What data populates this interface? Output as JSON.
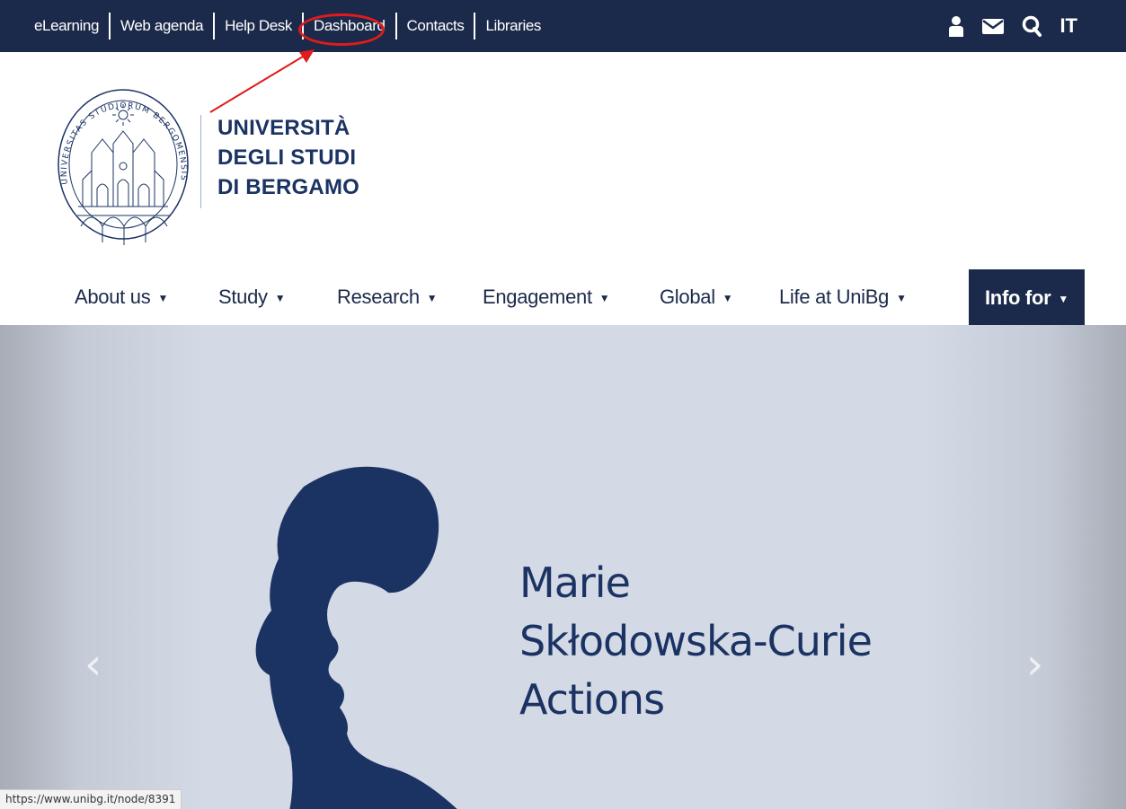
{
  "topbar": {
    "links": [
      {
        "label": "eLearning"
      },
      {
        "label": "Web agenda"
      },
      {
        "label": "Help Desk"
      },
      {
        "label": "Dashboard"
      },
      {
        "label": "Contacts"
      },
      {
        "label": "Libraries"
      }
    ],
    "icons": [
      "user-icon",
      "mail-icon",
      "search-icon"
    ],
    "language": "IT"
  },
  "logo": {
    "seal_text": "UNIVERSITAS STUDIORUM BERGOMENSIS",
    "line1": "UNIVERSITÀ",
    "line2": "DEGLI STUDI",
    "line3": "DI BERGAMO"
  },
  "nav": {
    "items": [
      {
        "label": "About us"
      },
      {
        "label": "Study"
      },
      {
        "label": "Research"
      },
      {
        "label": "Engagement"
      },
      {
        "label": "Global"
      },
      {
        "label": "Life at UniBg"
      },
      {
        "label": "Info for"
      }
    ]
  },
  "hero": {
    "title_line1": "Marie",
    "title_line2": "Skłodowska-Curie",
    "title_line3": "Actions",
    "prev_arrow": "‹",
    "next_arrow": "›"
  },
  "status_url": "https://www.unibg.it/node/8391",
  "colors": {
    "brand_navy": "#1b2a4a",
    "brand_blue": "#1b3363",
    "annotation_red": "#e11b1b",
    "hero_bg": "#d3d9e5"
  }
}
